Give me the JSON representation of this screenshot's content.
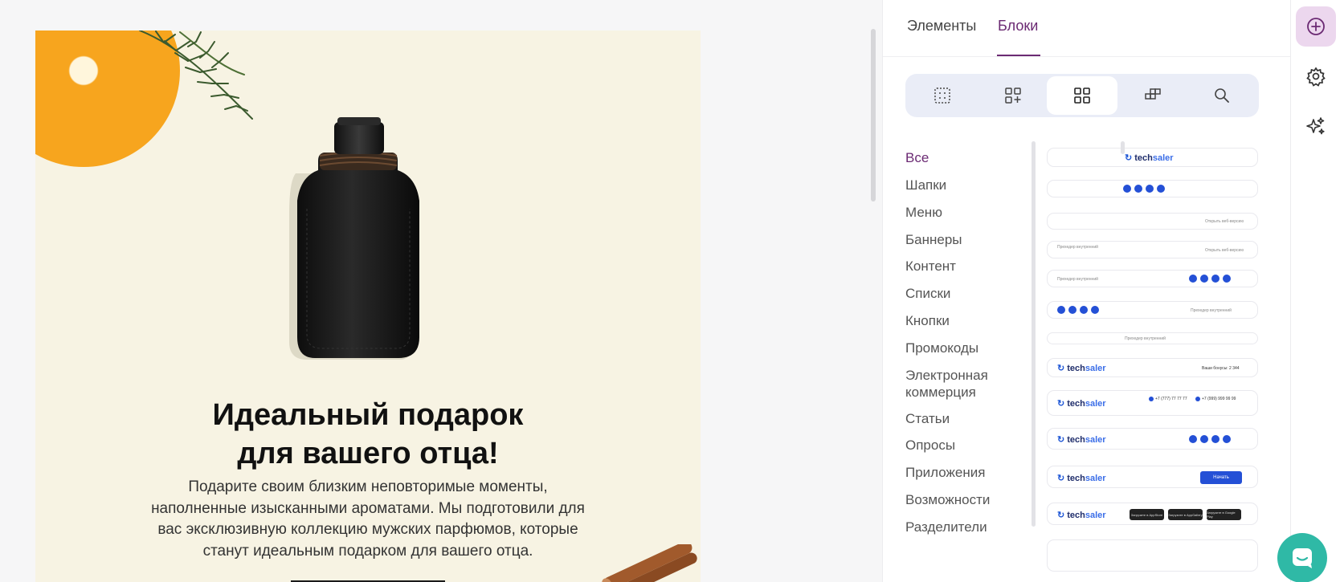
{
  "email": {
    "headline_line1": "Идеальный подарок",
    "headline_line2": "для вашего отца!",
    "body": "Подарите своим близким неповторимые моменты, наполненные изысканными ароматами. Мы подготовили для вас эксклюзивную коллекцию мужских парфюмов, которые станут идеальным подарком для вашего отца."
  },
  "panel": {
    "tabs": [
      {
        "label": "Элементы",
        "active": false
      },
      {
        "label": "Блоки",
        "active": true
      }
    ],
    "segments": [
      {
        "icon": "grid-dotted-icon"
      },
      {
        "icon": "add-grid-icon"
      },
      {
        "icon": "grid-four-icon",
        "active": true
      },
      {
        "icon": "saved-blocks-icon"
      },
      {
        "icon": "search-icon"
      }
    ],
    "categories": [
      {
        "label": "Все",
        "active": true
      },
      {
        "label": "Шапки"
      },
      {
        "label": "Меню"
      },
      {
        "label": "Баннеры"
      },
      {
        "label": "Контент"
      },
      {
        "label": "Списки"
      },
      {
        "label": "Кнопки"
      },
      {
        "label": "Промокоды"
      },
      {
        "label": "Электронная коммерция"
      },
      {
        "label": "Статьи"
      },
      {
        "label": "Опросы"
      },
      {
        "label": "Приложения"
      },
      {
        "label": "Возможности"
      },
      {
        "label": "Разделители"
      }
    ],
    "blocks": {
      "logo_part1": "tech",
      "logo_part2": "saler",
      "web_version": "Открыть веб-версию",
      "preheader": "Прехедер внутренний",
      "bonus": "Ваши бонусы: 2 344",
      "phone1": "+7 (777) 77 77 77",
      "phone2": "+7 (999) 999 99 99",
      "start_button": "Начать",
      "appstore": "Загрузите в AppStore",
      "appgallery": "Загрузите в AppGallery",
      "googleplay": "Загрузите в Google Play"
    }
  },
  "rail": {
    "items": [
      {
        "icon": "plus-circle-icon",
        "active": true
      },
      {
        "icon": "gear-icon"
      },
      {
        "icon": "sparkles-icon"
      }
    ]
  },
  "colors": {
    "accent": "#6b2a73",
    "accent_bg": "#ecd7ee",
    "email_bg": "#f7f3e3",
    "block_blue": "#2450d6",
    "chat": "#2fb9a6"
  }
}
